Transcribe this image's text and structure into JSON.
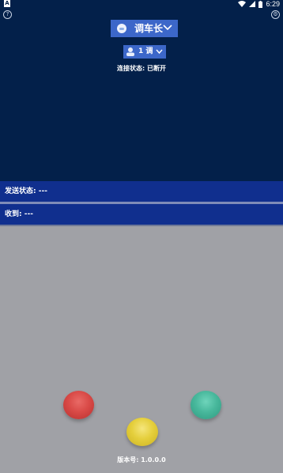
{
  "status_bar": {
    "notif_letter": "A",
    "time": "6:29"
  },
  "header": {
    "vehicle_label": "调车长",
    "channel_label": "1 调",
    "connection_prefix": "连接状态:",
    "connection_value": "已断开"
  },
  "send_status": {
    "label": "发送状态:",
    "value": "---"
  },
  "received": {
    "label": "收到:",
    "value": "---"
  },
  "buttons": {
    "red_color": "#d94a47",
    "green_color": "#48b89c",
    "yellow_color": "#e5cf3c"
  },
  "footer": {
    "version_label": "版本号:",
    "version_value": "1.0.0.0"
  },
  "icons": {
    "help": "question-circle-icon",
    "settings": "gear-icon"
  }
}
